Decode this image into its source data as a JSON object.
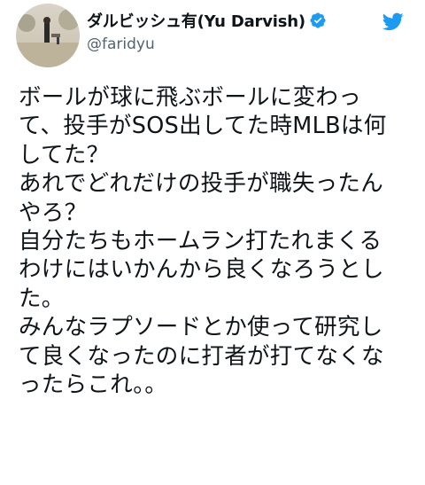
{
  "header": {
    "display_name": "ダルビッシュ有(Yu Darvish)",
    "handle": "@faridyu",
    "avatar_icon": "avatar-photo",
    "verified_icon": "verified-badge-icon",
    "brand_icon": "twitter-bird-icon"
  },
  "colors": {
    "verified_blue": "#1d9bf0",
    "brand_blue": "#1d9bf0",
    "text": "#0f1419",
    "secondary_text": "#536471"
  },
  "tweet": {
    "lines": [
      "ボールが球に飛ぶボールに変わっ",
      "て、投手がSOS出してた時MLBは何",
      "してた？",
      "あれでどれだけの投手が職失ったん",
      "やろ？",
      "自分たちもホームラン打たれまくる",
      "わけにはいかんから良くなろうとし",
      "た。",
      "みんなラプソードとか使って研究し",
      "て良くなったのに打者が打てなくな",
      "ったらこれ。。"
    ]
  }
}
